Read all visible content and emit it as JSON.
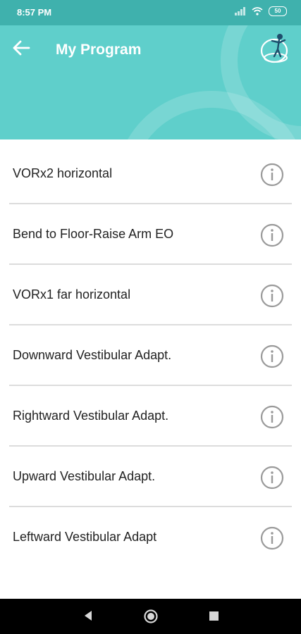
{
  "status_bar": {
    "time": "8:57 PM",
    "battery": "50"
  },
  "header": {
    "title": "My Program"
  },
  "exercises": [
    {
      "label": "VORx2 horizontal"
    },
    {
      "label": "Bend to Floor-Raise Arm EO"
    },
    {
      "label": "VORx1 far horizontal"
    },
    {
      "label": "Downward Vestibular Adapt."
    },
    {
      "label": "Rightward Vestibular Adapt."
    },
    {
      "label": "Upward Vestibular Adapt."
    },
    {
      "label": "Leftward Vestibular Adapt"
    }
  ],
  "colors": {
    "header": "#5fcfcb",
    "status_bar": "#3fb1ad",
    "divider": "#dcdcdc",
    "icon": "#9a9a9a"
  }
}
